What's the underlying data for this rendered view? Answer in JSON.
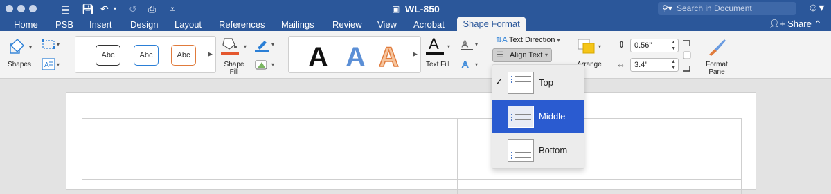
{
  "window": {
    "title": "WL-850",
    "search_placeholder": "Search in Document"
  },
  "tabs": [
    "Home",
    "PSB",
    "Insert",
    "Design",
    "Layout",
    "References",
    "Mailings",
    "Review",
    "View",
    "Acrobat",
    "Shape Format"
  ],
  "active_tab": "Shape Format",
  "share_label": "Share",
  "ribbon": {
    "shapes_label": "Shapes",
    "style_samples": [
      "Abc",
      "Abc",
      "Abc"
    ],
    "shape_fill_label": "Shape Fill",
    "wordart_samples": [
      "A",
      "A",
      "A"
    ],
    "text_fill_label": "Text Fill",
    "text_direction_label": "Text Direction",
    "align_text_label": "Align Text",
    "arrange_label": "Arrange",
    "height_value": "0.56\"",
    "width_value": "3.4\"",
    "format_pane_label": "Format Pane"
  },
  "align_menu": {
    "items": [
      {
        "label": "Top",
        "checked": true
      },
      {
        "label": "Middle",
        "highlighted": true
      },
      {
        "label": "Bottom"
      }
    ]
  },
  "colors": {
    "title_bar": "#2b579a",
    "menu_highlight": "#2a5bd0",
    "shape_fill_accent": "#e4572e",
    "outline_accent": "#2b579a"
  }
}
